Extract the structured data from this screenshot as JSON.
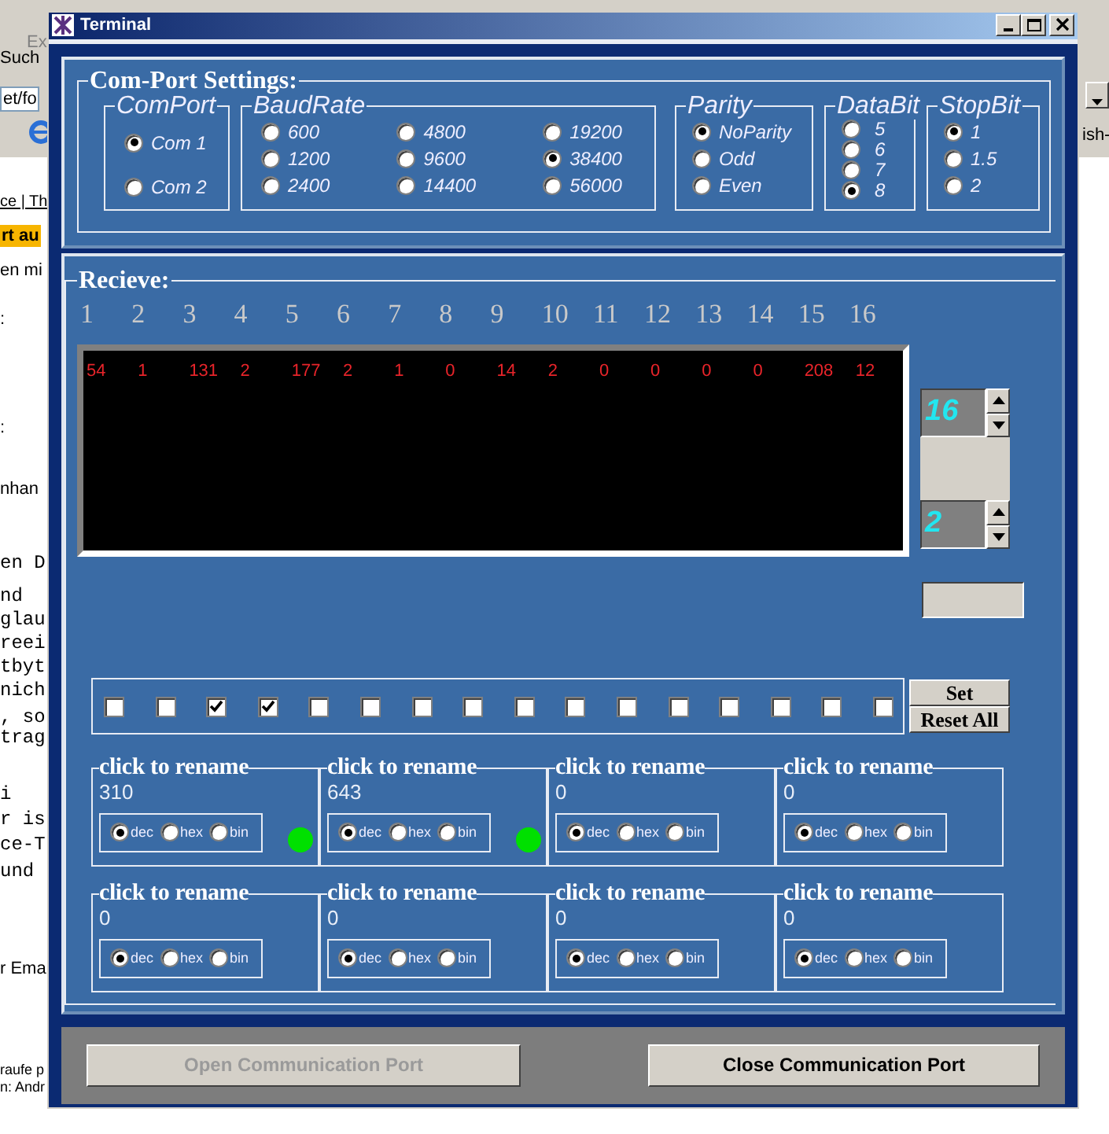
{
  "background_browser": {
    "left_fragments": [
      {
        "text": "Ex",
        "kind": "menu"
      },
      {
        "text": "Such",
        "kind": "toolbar"
      },
      {
        "text": "et/fo",
        "kind": "address"
      },
      {
        "text": "ce | Th",
        "kind": "link"
      },
      {
        "text": "rt au",
        "kind": "highlight"
      },
      {
        "text": "en mi",
        "kind": "plain"
      },
      {
        "text": ":",
        "kind": "plain"
      },
      {
        "text": ":",
        "kind": "plain"
      },
      {
        "text": "nhan",
        "kind": "plain"
      },
      {
        "text": "en D",
        "kind": "mono"
      },
      {
        "text": "nd",
        "kind": "mono"
      },
      {
        "text": "glau",
        "kind": "mono"
      },
      {
        "text": "reei",
        "kind": "mono"
      },
      {
        "text": "tbyt",
        "kind": "mono"
      },
      {
        "text": "nich",
        "kind": "mono"
      },
      {
        "text": ", so",
        "kind": "mono"
      },
      {
        "text": "trag",
        "kind": "mono"
      },
      {
        "text": "i",
        "kind": "mono"
      },
      {
        "text": "r is",
        "kind": "mono"
      },
      {
        "text": "ce-T",
        "kind": "mono"
      },
      {
        "text": "und",
        "kind": "mono"
      },
      {
        "text": "r Ema",
        "kind": "plain"
      },
      {
        "text": "raufe p",
        "kind": "small"
      },
      {
        "text": "n: Andr",
        "kind": "small"
      }
    ],
    "right_fragments": [
      {
        "text": "ish-"
      }
    ]
  },
  "window": {
    "title": "Terminal"
  },
  "settings": {
    "title": "Com-Port Settings:",
    "groups": [
      {
        "title": "ComPort",
        "kind": "comport",
        "options": [
          {
            "label": "Com 1",
            "selected": true
          },
          {
            "label": "Com 2",
            "selected": false
          }
        ]
      },
      {
        "title": "BaudRate",
        "kind": "baud",
        "options": [
          {
            "label": "600",
            "selected": false
          },
          {
            "label": "1200",
            "selected": false
          },
          {
            "label": "2400",
            "selected": false
          },
          {
            "label": "4800",
            "selected": false
          },
          {
            "label": "9600",
            "selected": false
          },
          {
            "label": "14400",
            "selected": false
          },
          {
            "label": "19200",
            "selected": false
          },
          {
            "label": "38400",
            "selected": true
          },
          {
            "label": "56000",
            "selected": false
          }
        ]
      },
      {
        "title": "Parity",
        "kind": "parity",
        "options": [
          {
            "label": "NoParity",
            "selected": true
          },
          {
            "label": "Odd",
            "selected": false
          },
          {
            "label": "Even",
            "selected": false
          }
        ]
      },
      {
        "title": "DataBit",
        "kind": "databit",
        "options": [
          {
            "label": "5",
            "selected": false
          },
          {
            "label": "6",
            "selected": false
          },
          {
            "label": "7",
            "selected": false
          },
          {
            "label": "8",
            "selected": true
          }
        ]
      },
      {
        "title": "StopBit",
        "kind": "stopbit",
        "options": [
          {
            "label": "1",
            "selected": true
          },
          {
            "label": "1.5",
            "selected": false
          },
          {
            "label": "2",
            "selected": false
          }
        ]
      }
    ]
  },
  "receive": {
    "title": "Recieve:",
    "column_numbers": [
      "1",
      "2",
      "3",
      "4",
      "5",
      "6",
      "7",
      "8",
      "9",
      "10",
      "11",
      "12",
      "13",
      "14",
      "15",
      "16"
    ],
    "values": [
      "54",
      "1",
      "131",
      "2",
      "177",
      "2",
      "1",
      "0",
      "14",
      "2",
      "0",
      "0",
      "0",
      "0",
      "208",
      "12"
    ],
    "spinners": [
      {
        "value": "16"
      },
      {
        "value": "2"
      }
    ],
    "checkboxes": [
      {
        "checked": false
      },
      {
        "checked": false
      },
      {
        "checked": true
      },
      {
        "checked": true
      },
      {
        "checked": false
      },
      {
        "checked": false
      },
      {
        "checked": false
      },
      {
        "checked": false
      },
      {
        "checked": false
      },
      {
        "checked": false
      },
      {
        "checked": false
      },
      {
        "checked": false
      },
      {
        "checked": false
      },
      {
        "checked": false
      },
      {
        "checked": false
      },
      {
        "checked": false
      }
    ],
    "buttons": [
      "Set",
      "Reset All"
    ],
    "channels": [
      {
        "name": "click to rename",
        "value": "310",
        "indicator_on": true,
        "formats": [
          {
            "label": "dec",
            "selected": true
          },
          {
            "label": "hex",
            "selected": false
          },
          {
            "label": "bin",
            "selected": false
          }
        ]
      },
      {
        "name": "click to rename",
        "value": "643",
        "indicator_on": true,
        "formats": [
          {
            "label": "dec",
            "selected": true
          },
          {
            "label": "hex",
            "selected": false
          },
          {
            "label": "bin",
            "selected": false
          }
        ]
      },
      {
        "name": "click to rename",
        "value": "0",
        "indicator_on": false,
        "formats": [
          {
            "label": "dec",
            "selected": true
          },
          {
            "label": "hex",
            "selected": false
          },
          {
            "label": "bin",
            "selected": false
          }
        ]
      },
      {
        "name": "click to rename",
        "value": "0",
        "indicator_on": false,
        "formats": [
          {
            "label": "dec",
            "selected": true
          },
          {
            "label": "hex",
            "selected": false
          },
          {
            "label": "bin",
            "selected": false
          }
        ]
      },
      {
        "name": "click to rename",
        "value": "0",
        "indicator_on": false,
        "formats": [
          {
            "label": "dec",
            "selected": true
          },
          {
            "label": "hex",
            "selected": false
          },
          {
            "label": "bin",
            "selected": false
          }
        ]
      },
      {
        "name": "click to rename",
        "value": "0",
        "indicator_on": false,
        "formats": [
          {
            "label": "dec",
            "selected": true
          },
          {
            "label": "hex",
            "selected": false
          },
          {
            "label": "bin",
            "selected": false
          }
        ]
      },
      {
        "name": "click to rename",
        "value": "0",
        "indicator_on": false,
        "formats": [
          {
            "label": "dec",
            "selected": true
          },
          {
            "label": "hex",
            "selected": false
          },
          {
            "label": "bin",
            "selected": false
          }
        ]
      },
      {
        "name": "click to rename",
        "value": "0",
        "indicator_on": false,
        "formats": [
          {
            "label": "dec",
            "selected": true
          },
          {
            "label": "hex",
            "selected": false
          },
          {
            "label": "bin",
            "selected": false
          }
        ]
      }
    ]
  },
  "footer": {
    "buttons": [
      {
        "label": "Open Communication Port",
        "disabled": true
      },
      {
        "label": "Close Communication Port",
        "disabled": false
      }
    ]
  }
}
